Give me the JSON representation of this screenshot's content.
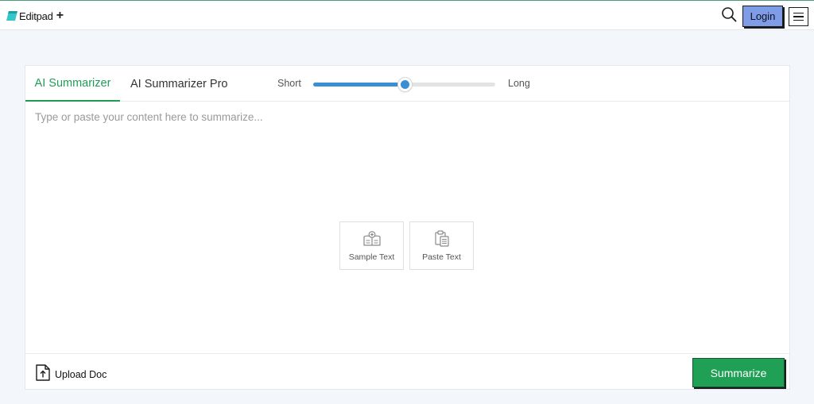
{
  "header": {
    "logo_text": "Editpad",
    "logo_plus": "+",
    "login_label": "Login"
  },
  "tabs": [
    {
      "label": "AI Summarizer",
      "active": true
    },
    {
      "label": "AI Summarizer Pro",
      "active": false
    }
  ],
  "length_slider": {
    "min_label": "Short",
    "max_label": "Long",
    "value_fraction": 0.5
  },
  "editor": {
    "placeholder": "Type or paste your content here to summarize...",
    "value": ""
  },
  "actions": {
    "sample_label": "Sample Text",
    "paste_label": "Paste Text"
  },
  "footer": {
    "upload_label": "Upload Doc",
    "summarize_label": "Summarize"
  },
  "colors": {
    "accent_green": "#1fa055",
    "slider_blue": "#3a8fd3",
    "login_blue": "#7f9de6"
  }
}
